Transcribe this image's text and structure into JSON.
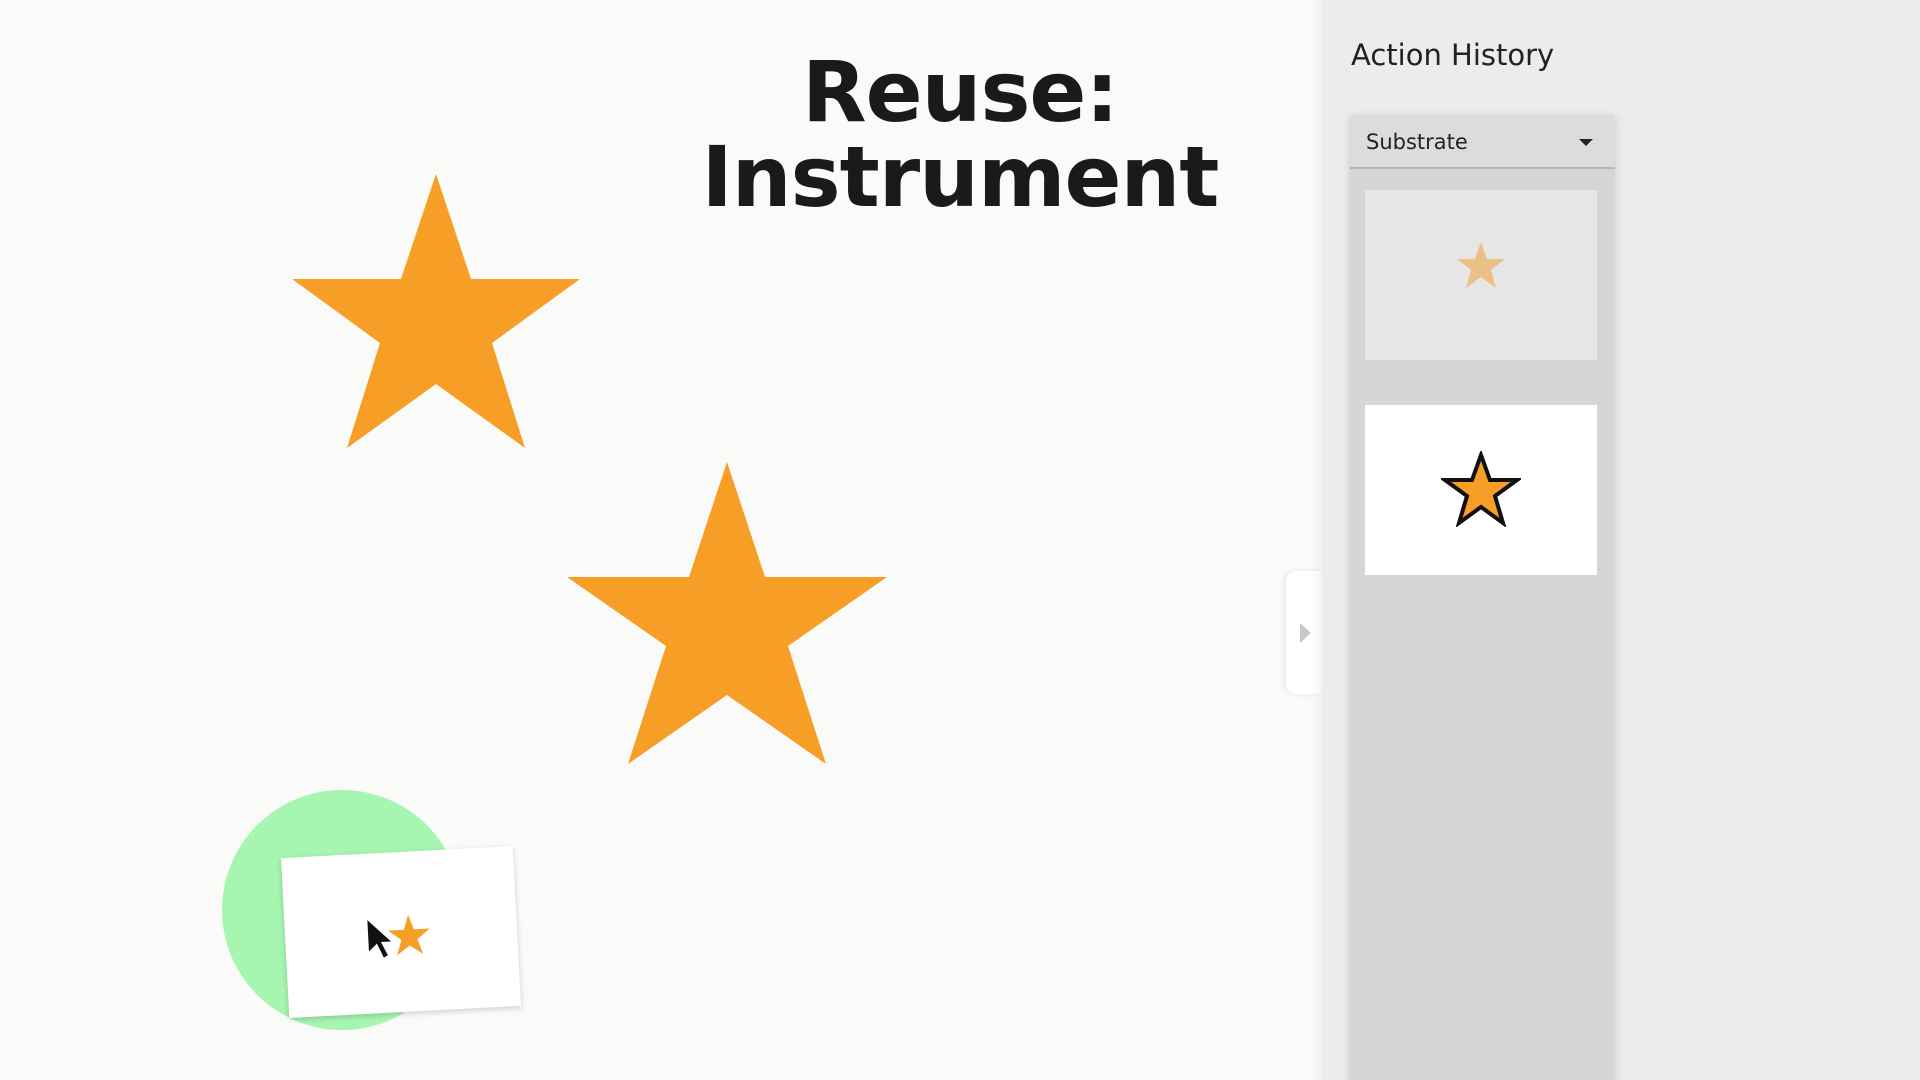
{
  "slide": {
    "title_line1": "Reuse:",
    "title_line2": "Instrument"
  },
  "canvas": {
    "shapes": [
      {
        "type": "star",
        "fill": "#f79e27"
      },
      {
        "type": "star",
        "fill": "#f79e27"
      }
    ],
    "instrument": {
      "highlight_color": "#a6f5b0",
      "icon": "star-icon",
      "cursor_icon": "cursor-arrow-icon"
    }
  },
  "panel": {
    "title": "Action History",
    "dropdown": {
      "selected": "Substrate"
    },
    "history_items": [
      {
        "icon": "star-faded-icon",
        "fill": "#ebc088",
        "state": "faded"
      },
      {
        "icon": "star-outlined-icon",
        "fill": "#f79e27",
        "stroke": "#111111",
        "state": "active"
      }
    ],
    "collapse_handle_icon": "chevron-right-icon"
  },
  "colors": {
    "accent_orange": "#f79e27",
    "highlight_green": "#a6f5b0",
    "panel_bg": "#ececeb",
    "history_bg": "#d6d6d6"
  }
}
